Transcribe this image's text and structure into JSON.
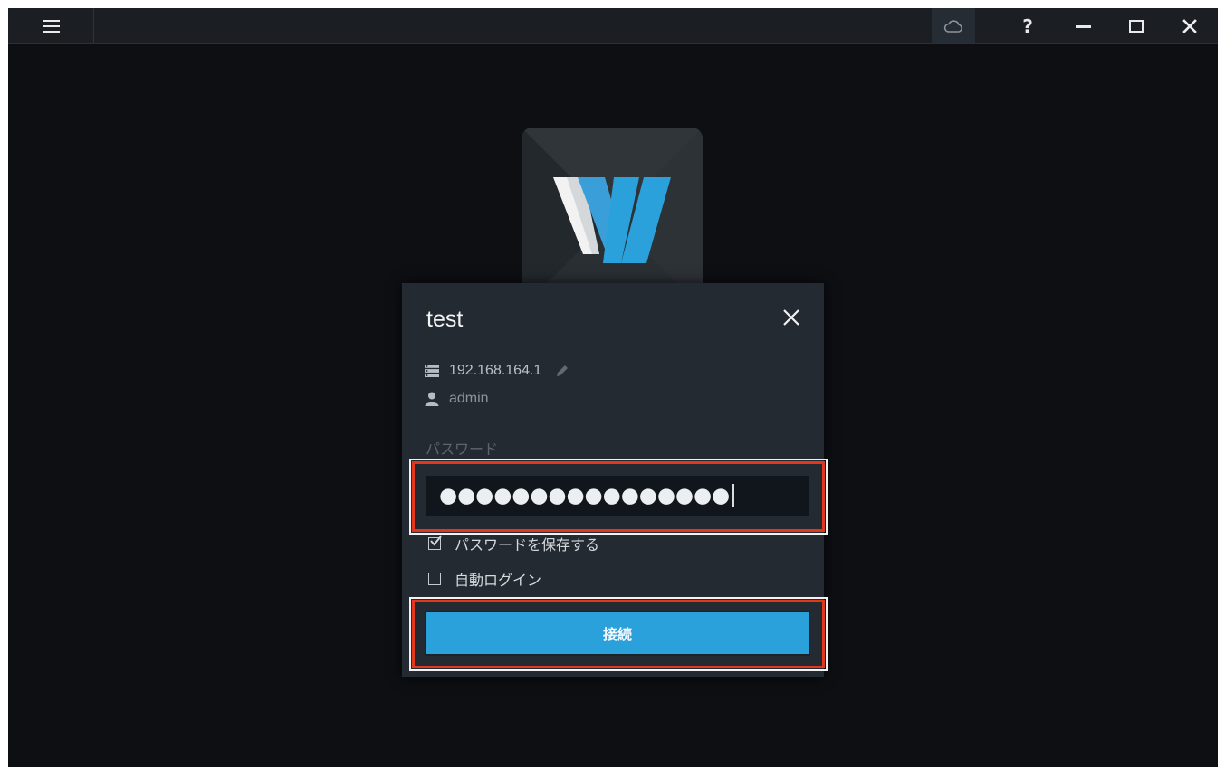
{
  "titlebar": {
    "menu_icon": "hamburger-menu-icon",
    "cloud_icon": "cloud-icon",
    "help_label": "?",
    "minimize_icon": "minimize-icon",
    "maximize_icon": "maximize-icon",
    "close_icon": "close-icon"
  },
  "logo": {
    "letter": "W",
    "colors": {
      "tile": "#2a2f34",
      "left_stroke": "#f2f2f2",
      "right_stroke": "#2ba1dc"
    }
  },
  "dialog": {
    "title": "test",
    "server_address": "192.168.164.1",
    "username": "admin",
    "password_label": "パスワード",
    "password_masked": "●●●●●●●●●●●●●●●●",
    "save_password_label": "パスワードを保存する",
    "save_password_checked": true,
    "auto_login_label": "自動ログイン",
    "auto_login_checked": false,
    "connect_label": "接続"
  },
  "colors": {
    "window_bg": "#0d0f13",
    "dialog_bg": "#242a31",
    "accent": "#2ba1dc",
    "highlight": "#e1371c"
  }
}
